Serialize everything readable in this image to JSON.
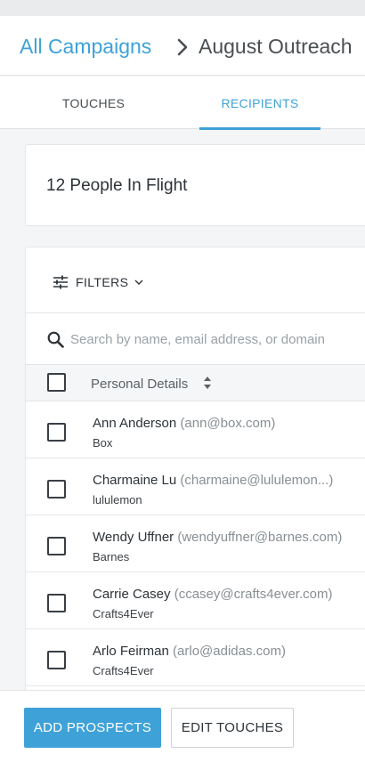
{
  "breadcrumb": {
    "parent_label": "All Campaigns",
    "current_label": "August Outreach"
  },
  "tabs": [
    {
      "label": "TOUCHES",
      "active": false
    },
    {
      "label": "RECIPIENTS",
      "active": true
    }
  ],
  "summary": {
    "text": "12 People In Flight"
  },
  "filters": {
    "label": "FILTERS"
  },
  "search": {
    "placeholder": "Search by name, email address, or domain",
    "value": ""
  },
  "table": {
    "column_header": "Personal Details",
    "rows": [
      {
        "name": "Ann Anderson",
        "email": "(ann@box.com)",
        "company": "Box"
      },
      {
        "name": "Charmaine Lu",
        "email": "(charmaine@lululemon...)",
        "company": "lululemon"
      },
      {
        "name": "Wendy Uffner",
        "email": "(wendyuffner@barnes.com)",
        "company": "Barnes"
      },
      {
        "name": "Carrie Casey",
        "email": "(ccasey@crafts4ever.com)",
        "company": "Crafts4Ever"
      },
      {
        "name": "Arlo Feirman",
        "email": "(arlo@adidas.com)",
        "company": "Crafts4Ever"
      }
    ]
  },
  "footer": {
    "primary_label": "ADD PROSPECTS",
    "secondary_label": "EDIT TOUCHES"
  },
  "colors": {
    "accent": "#3ea2d8",
    "text": "#2d3338",
    "muted": "#888f94"
  },
  "icons": [
    "chevron-right-icon",
    "sliders-icon",
    "chevron-down-icon",
    "search-icon",
    "sort-icon"
  ]
}
